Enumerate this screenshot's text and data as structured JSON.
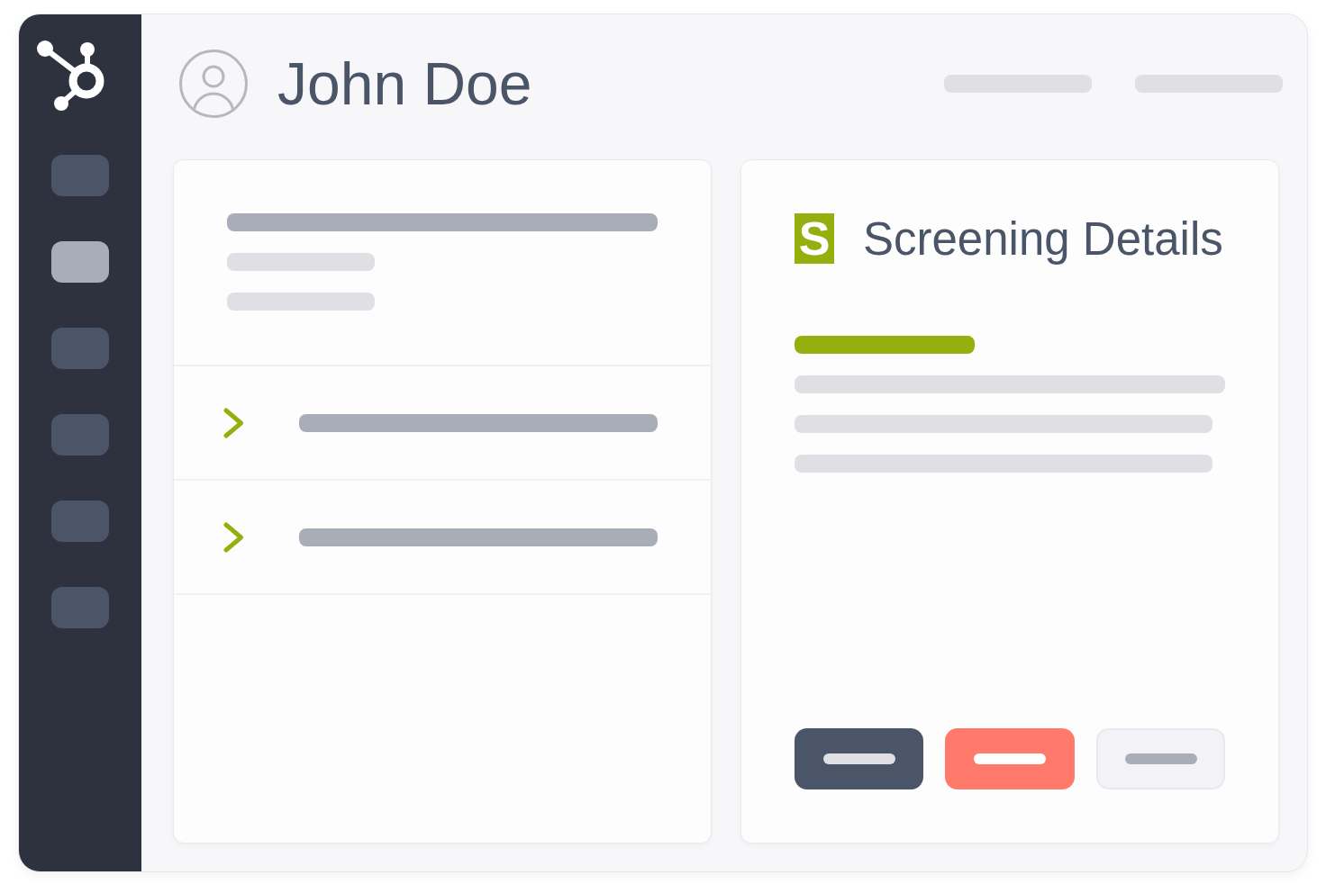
{
  "sidebar": {
    "items": [
      {
        "selected": false
      },
      {
        "selected": true
      },
      {
        "selected": false
      },
      {
        "selected": false
      },
      {
        "selected": false
      },
      {
        "selected": false
      }
    ]
  },
  "header": {
    "title": "John Doe"
  },
  "list_card": {
    "rows": [
      {
        "expanded": false
      },
      {
        "expanded": false
      }
    ]
  },
  "details_card": {
    "logo_letter": "S",
    "title": "Screening Details",
    "buttons": [
      {
        "kind": "primary"
      },
      {
        "kind": "danger"
      },
      {
        "kind": "secondary"
      }
    ]
  }
}
